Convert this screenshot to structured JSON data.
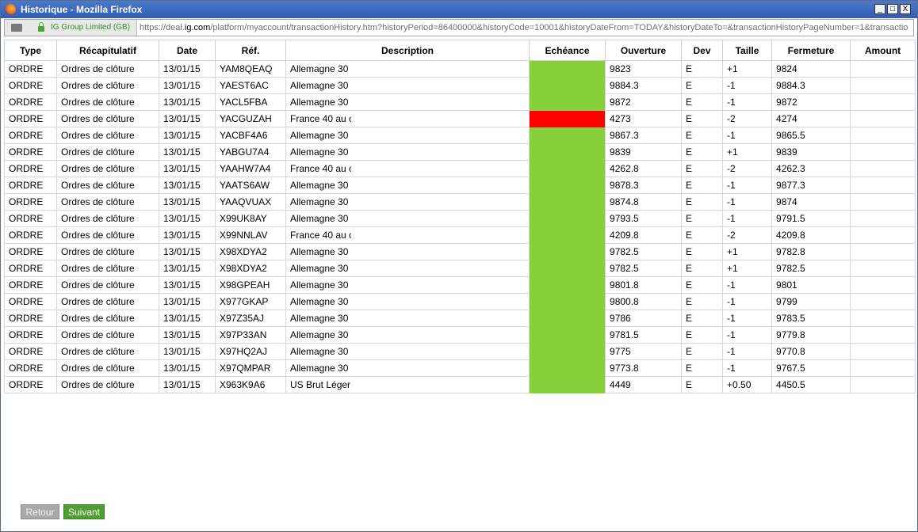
{
  "window": {
    "title": "Historique - Mozilla Firefox",
    "min_glyph": "_",
    "max_glyph": "□",
    "close_glyph": "X"
  },
  "urlbar": {
    "site_name": "IG Group Limited (GB)",
    "url_prefix": "https://deal.",
    "url_domain": "ig.com",
    "url_rest": "/platform/myaccount/transactionHistory.htm?historyPeriod=86400000&historyCode=10001&historyDateFrom=TODAY&historyDateTo=&transactionHistoryPageNumber=1&transactio"
  },
  "table": {
    "headers": [
      "Type",
      "Récapitulatif",
      "Date",
      "Réf.",
      "Description",
      "Echéance",
      "Ouverture",
      "Dev",
      "Taille",
      "Fermeture",
      "Amount"
    ],
    "colors": {
      "green": "#86d13b",
      "red": "#ff0000"
    },
    "rows": [
      {
        "type": "ORDRE",
        "recap": "Ordres de clôture",
        "date": "13/01/15",
        "ref": "YAM8QEAQ",
        "desc": "Allemagne 30",
        "status": "green",
        "open": "9823",
        "dev": "E",
        "size": "+1",
        "close": "9824",
        "amount": ""
      },
      {
        "type": "ORDRE",
        "recap": "Ordres de clôture",
        "date": "13/01/15",
        "ref": "YAEST6AC",
        "desc": "Allemagne 30",
        "status": "green",
        "open": "9884.3",
        "dev": "E",
        "size": "-1",
        "close": "9884.3",
        "amount": ""
      },
      {
        "type": "ORDRE",
        "recap": "Ordres de clôture",
        "date": "13/01/15",
        "ref": "YACL5FBA",
        "desc": "Allemagne 30",
        "status": "green",
        "open": "9872",
        "dev": "E",
        "size": "-1",
        "close": "9872",
        "amount": ""
      },
      {
        "type": "ORDRE",
        "recap": "Ordres de clôture",
        "date": "13/01/15",
        "ref": "YACGUZAH",
        "desc": "France 40 au c",
        "status": "red",
        "open": "4273",
        "dev": "E",
        "size": "-2",
        "close": "4274",
        "amount": ""
      },
      {
        "type": "ORDRE",
        "recap": "Ordres de clôture",
        "date": "13/01/15",
        "ref": "YACBF4A6",
        "desc": "Allemagne 30",
        "status": "green",
        "open": "9867.3",
        "dev": "E",
        "size": "-1",
        "close": "9865.5",
        "amount": ""
      },
      {
        "type": "ORDRE",
        "recap": "Ordres de clôture",
        "date": "13/01/15",
        "ref": "YABGU7A4",
        "desc": "Allemagne 30",
        "status": "green",
        "open": "9839",
        "dev": "E",
        "size": "+1",
        "close": "9839",
        "amount": ""
      },
      {
        "type": "ORDRE",
        "recap": "Ordres de clôture",
        "date": "13/01/15",
        "ref": "YAAHW7A4",
        "desc": "France 40 au c",
        "status": "green",
        "open": "4262.8",
        "dev": "E",
        "size": "-2",
        "close": "4262.3",
        "amount": ""
      },
      {
        "type": "ORDRE",
        "recap": "Ordres de clôture",
        "date": "13/01/15",
        "ref": "YAATS6AW",
        "desc": "Allemagne 30",
        "status": "green",
        "open": "9878.3",
        "dev": "E",
        "size": "-1",
        "close": "9877.3",
        "amount": ""
      },
      {
        "type": "ORDRE",
        "recap": "Ordres de clôture",
        "date": "13/01/15",
        "ref": "YAAQVUAX",
        "desc": "Allemagne 30",
        "status": "green",
        "open": "9874.8",
        "dev": "E",
        "size": "-1",
        "close": "9874",
        "amount": ""
      },
      {
        "type": "ORDRE",
        "recap": "Ordres de clôture",
        "date": "13/01/15",
        "ref": "X99UK8AY",
        "desc": "Allemagne 30",
        "status": "green",
        "open": "9793.5",
        "dev": "E",
        "size": "-1",
        "close": "9791.5",
        "amount": ""
      },
      {
        "type": "ORDRE",
        "recap": "Ordres de clôture",
        "date": "13/01/15",
        "ref": "X99NNLAV",
        "desc": "France 40 au c",
        "status": "green",
        "open": "4209.8",
        "dev": "E",
        "size": "-2",
        "close": "4209.8",
        "amount": ""
      },
      {
        "type": "ORDRE",
        "recap": "Ordres de clôture",
        "date": "13/01/15",
        "ref": "X98XDYA2",
        "desc": "Allemagne 30",
        "status": "green",
        "open": "9782.5",
        "dev": "E",
        "size": "+1",
        "close": "9782.8",
        "amount": ""
      },
      {
        "type": "ORDRE",
        "recap": "Ordres de clôture",
        "date": "13/01/15",
        "ref": "X98XDYA2",
        "desc": "Allemagne 30",
        "status": "green",
        "open": "9782.5",
        "dev": "E",
        "size": "+1",
        "close": "9782.5",
        "amount": ""
      },
      {
        "type": "ORDRE",
        "recap": "Ordres de clôture",
        "date": "13/01/15",
        "ref": "X98GPEAH",
        "desc": "Allemagne 30",
        "status": "green",
        "open": "9801.8",
        "dev": "E",
        "size": "-1",
        "close": "9801",
        "amount": ""
      },
      {
        "type": "ORDRE",
        "recap": "Ordres de clôture",
        "date": "13/01/15",
        "ref": "X977GKAP",
        "desc": "Allemagne 30",
        "status": "green",
        "open": "9800.8",
        "dev": "E",
        "size": "-1",
        "close": "9799",
        "amount": ""
      },
      {
        "type": "ORDRE",
        "recap": "Ordres de clôture",
        "date": "13/01/15",
        "ref": "X97Z35AJ",
        "desc": "Allemagne 30",
        "status": "green",
        "open": "9786",
        "dev": "E",
        "size": "-1",
        "close": "9783.5",
        "amount": ""
      },
      {
        "type": "ORDRE",
        "recap": "Ordres de clôture",
        "date": "13/01/15",
        "ref": "X97P33AN",
        "desc": "Allemagne 30",
        "status": "green",
        "open": "9781.5",
        "dev": "E",
        "size": "-1",
        "close": "9779.8",
        "amount": ""
      },
      {
        "type": "ORDRE",
        "recap": "Ordres de clôture",
        "date": "13/01/15",
        "ref": "X97HQ2AJ",
        "desc": "Allemagne 30",
        "status": "green",
        "open": "9775",
        "dev": "E",
        "size": "-1",
        "close": "9770.8",
        "amount": ""
      },
      {
        "type": "ORDRE",
        "recap": "Ordres de clôture",
        "date": "13/01/15",
        "ref": "X97QMPAR",
        "desc": "Allemagne 30",
        "status": "green",
        "open": "9773.8",
        "dev": "E",
        "size": "-1",
        "close": "9767.5",
        "amount": ""
      },
      {
        "type": "ORDRE",
        "recap": "Ordres de clôture",
        "date": "13/01/15",
        "ref": "X963K9A6",
        "desc": "US Brut Léger",
        "status": "green",
        "open": "4449",
        "dev": "E",
        "size": "+0.50",
        "close": "4450.5",
        "amount": ""
      }
    ]
  },
  "pagination": {
    "back_label": "Retour",
    "next_label": "Suivant"
  }
}
